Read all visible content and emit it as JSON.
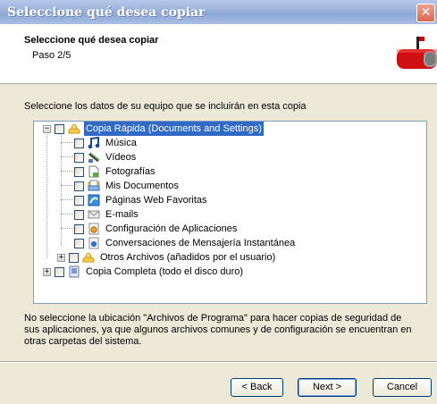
{
  "window": {
    "title": "Seleccione qué desea copiar",
    "close_glyph": "✕"
  },
  "header": {
    "title": "Seleccione qué desea copiar",
    "step": "Paso 2/5",
    "icon": "mailbox-icon"
  },
  "intro_text": "Seleccione los datos de su equipo que se incluirán en esta copia",
  "tree": {
    "quick_copy": {
      "label": "Copia Rápida (Documents and Settings)",
      "expander": "−",
      "selected": true
    },
    "items": [
      {
        "label": "Música",
        "icon": "music-icon"
      },
      {
        "label": "Vídeos",
        "icon": "video-icon"
      },
      {
        "label": "Fotografías",
        "icon": "photo-icon"
      },
      {
        "label": "Mis Documentos",
        "icon": "documents-icon"
      },
      {
        "label": "Páginas Web Favoritas",
        "icon": "favorites-icon"
      },
      {
        "label": "E-mails",
        "icon": "email-icon"
      },
      {
        "label": "Configuración de Aplicaciones",
        "icon": "app-config-icon"
      },
      {
        "label": "Conversaciones de Mensajería Instantánea",
        "icon": "messenger-icon"
      }
    ],
    "other_files": {
      "label": "Otros Archivos (añadidos por el usuario)",
      "expander": "+"
    },
    "full_copy": {
      "label": "Copia Completa (todo el disco duro)",
      "expander": "+"
    }
  },
  "note": "No seleccione la ubicación \"Archivos de Programa\" para hacer copias de seguridad de sus aplicaciones, ya que algunos archivos comunes y de configuración se encuentran en otras carpetas del sistema.",
  "buttons": {
    "back": "< Back",
    "next": "Next >",
    "cancel": "Cancel"
  },
  "colors": {
    "selection": "#316ac5",
    "titlebar": "#9db4dc",
    "close": "#d9694e"
  }
}
